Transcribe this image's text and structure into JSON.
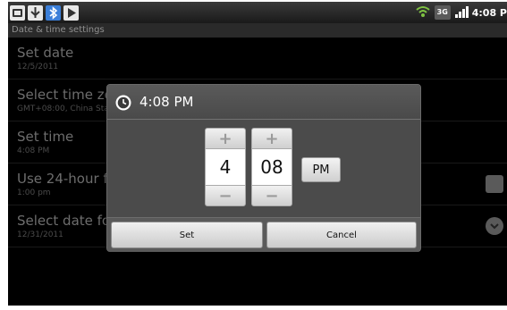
{
  "status_bar": {
    "left_icons": [
      "android-debug-icon",
      "usb-icon",
      "bluetooth-icon",
      "media-play-icon"
    ],
    "right_icons": [
      "wifi-icon",
      "3g-icon",
      "signal-icon"
    ],
    "network_label": "3G",
    "time": "4:08 P"
  },
  "section_header": "Date & time settings",
  "settings": [
    {
      "title": "Set date",
      "subtitle": "12/5/2011",
      "control": "none"
    },
    {
      "title": "Select time zo",
      "subtitle": "GMT+08:00, China Sta",
      "control": "none"
    },
    {
      "title": "Set time",
      "subtitle": "4:08 PM",
      "control": "none"
    },
    {
      "title": "Use 24-hour f",
      "subtitle": "1:00 pm",
      "control": "checkbox"
    },
    {
      "title": "Select date fo",
      "subtitle": "12/31/2011",
      "control": "chevron"
    }
  ],
  "dialog": {
    "title": "4:08 PM",
    "title_icon": "clock-icon",
    "hour": "4",
    "minute": "08",
    "ampm": "PM",
    "plus_symbol": "+",
    "minus_symbol": "−",
    "set_label": "Set",
    "cancel_label": "Cancel"
  }
}
